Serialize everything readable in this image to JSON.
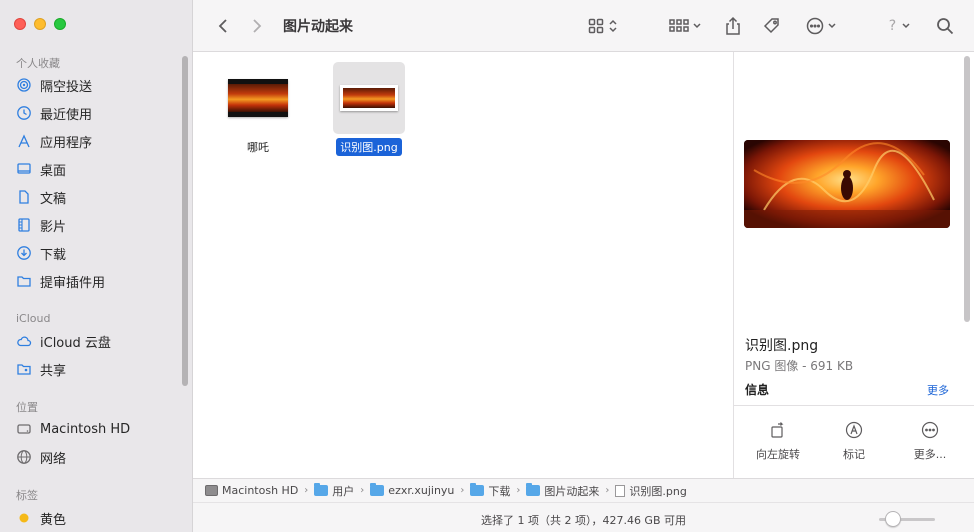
{
  "sidebar": {
    "favorites_header": "个人收藏",
    "favorites": [
      {
        "label": "隔空投送",
        "icon": "airdrop-icon"
      },
      {
        "label": "最近使用",
        "icon": "clock-icon"
      },
      {
        "label": "应用程序",
        "icon": "apps-icon"
      },
      {
        "label": "桌面",
        "icon": "desktop-icon"
      },
      {
        "label": "文稿",
        "icon": "document-icon"
      },
      {
        "label": "影片",
        "icon": "film-icon"
      },
      {
        "label": "下载",
        "icon": "download-icon"
      },
      {
        "label": "提审插件用",
        "icon": "folder-icon"
      }
    ],
    "icloud_header": "iCloud",
    "icloud": [
      {
        "label": "iCloud 云盘",
        "icon": "cloud-icon"
      },
      {
        "label": "共享",
        "icon": "shared-folder-icon"
      }
    ],
    "locations_header": "位置",
    "locations": [
      {
        "label": "Macintosh HD",
        "icon": "disk-icon"
      },
      {
        "label": "网络",
        "icon": "network-icon"
      }
    ],
    "tags_header": "标签",
    "tags": [
      {
        "label": "黄色",
        "color": "#f5b918"
      }
    ]
  },
  "toolbar": {
    "title": "图片动起来",
    "help_label": "?"
  },
  "files": [
    {
      "name": "哪吒",
      "selected": false
    },
    {
      "name": "识别图.png",
      "selected": true
    }
  ],
  "preview": {
    "name": "识别图.png",
    "kind": "PNG 图像 - 691 KB",
    "info_label": "信息",
    "more_label": "更多",
    "actions": [
      {
        "label": "向左旋转",
        "icon": "rotate-left-icon"
      },
      {
        "label": "标记",
        "icon": "markup-icon"
      },
      {
        "label": "更多...",
        "icon": "more-icon"
      }
    ]
  },
  "pathbar": {
    "crumbs": [
      {
        "label": "Macintosh HD",
        "icon": "disk-icon"
      },
      {
        "label": "用户",
        "icon": "folder-icon"
      },
      {
        "label": "ezxr.xujinyu",
        "icon": "home-folder-icon"
      },
      {
        "label": "下载",
        "icon": "downloads-folder-icon"
      },
      {
        "label": "图片动起来",
        "icon": "folder-icon"
      },
      {
        "label": "识别图.png",
        "icon": "file-icon"
      }
    ]
  },
  "statusbar": {
    "text": "选择了 1 项（共 2 项），427.46 GB 可用",
    "icon_size_level": 0.25
  }
}
